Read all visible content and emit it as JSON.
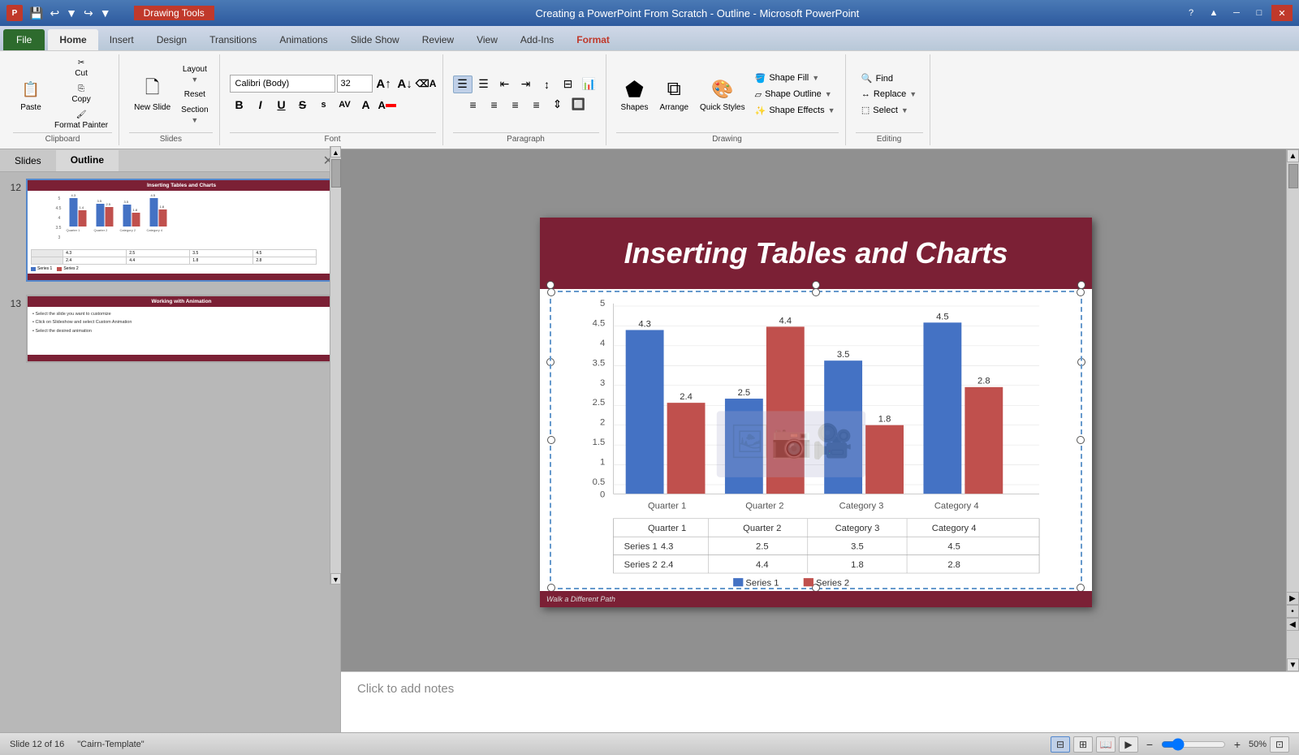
{
  "titleBar": {
    "appName": "Microsoft PowerPoint",
    "docTitle": "Creating a PowerPoint From Scratch - Outline - Microsoft PowerPoint",
    "drawingToolsTab": "Drawing Tools"
  },
  "tabs": {
    "file": "File",
    "home": "Home",
    "insert": "Insert",
    "design": "Design",
    "transitions": "Transitions",
    "animations": "Animations",
    "slideShow": "Slide Show",
    "review": "Review",
    "view": "View",
    "addIns": "Add-Ins",
    "format": "Format"
  },
  "ribbon": {
    "clipboard": {
      "label": "Clipboard",
      "paste": "Paste",
      "cut": "Cut",
      "copy": "Copy",
      "formatPainter": "Format Painter"
    },
    "slides": {
      "label": "Slides",
      "newSlide": "New Slide",
      "layout": "Layout",
      "reset": "Reset",
      "section": "Section"
    },
    "font": {
      "label": "Font",
      "fontName": "Calibri (Body)",
      "fontSize": "32",
      "bold": "B",
      "italic": "I",
      "underline": "U",
      "strikethrough": "S",
      "shadow": "s",
      "fontColor": "A"
    },
    "paragraph": {
      "label": "Paragraph",
      "bulletList": "≡",
      "numberedList": "≡",
      "decreaseIndent": "←",
      "increaseIndent": "→",
      "lineSpacing": "↕",
      "columns": "⊞"
    },
    "drawing": {
      "label": "Drawing",
      "shapes": "Shapes",
      "arrange": "Arrange",
      "quickStyles": "Quick Styles",
      "shapeFill": "Shape Fill",
      "shapeOutline": "Shape Outline",
      "shapeEffects": "Shape Effects"
    },
    "editing": {
      "label": "Editing",
      "find": "Find",
      "replace": "Replace",
      "select": "Select"
    }
  },
  "slidePanel": {
    "tabs": [
      "Slides",
      "Outline"
    ],
    "activeTab": "Outline",
    "slides": [
      {
        "number": "12",
        "title": "Inserting Tables and Charts",
        "isSelected": true
      },
      {
        "number": "13",
        "title": "Working with Animation",
        "isSelected": false
      }
    ]
  },
  "mainSlide": {
    "title": "Inserting Tables and Charts",
    "footerText": "Walk a Different Path",
    "chart": {
      "title": "",
      "categories": [
        "Quarter 1",
        "Quarter 2",
        "Category 3",
        "Category 4"
      ],
      "series1Label": "Series 1",
      "series2Label": "Series 2",
      "series1Values": [
        4.3,
        2.5,
        3.5,
        4.5
      ],
      "series2Values": [
        2.4,
        4.4,
        1.8,
        2.8
      ],
      "yAxisValues": [
        "0",
        "0.5",
        "1",
        "1.5",
        "2",
        "2.5",
        "3",
        "3.5",
        "4",
        "4.5",
        "5"
      ],
      "barLabels1": [
        "4.3",
        "2.5",
        "3.5",
        "4.5"
      ],
      "barLabels2": [
        "2.4",
        "4.4",
        "1.8",
        "2.8"
      ]
    },
    "table": {
      "headers": [
        "",
        "Quarter 1",
        "Quarter 2",
        "Category 3",
        "Category 4"
      ],
      "rows": [
        [
          "Series 1",
          "4.3",
          "2.5",
          "3.5",
          "4.5"
        ],
        [
          "Series 2",
          "2.4",
          "4.4",
          "1.8",
          "2.8"
        ]
      ]
    }
  },
  "slide13": {
    "title": "Working with Animation",
    "bullets": [
      "Select the slide you want to customize",
      "Click on Slideshow and select Custom Animation",
      "Select the desired animation"
    ]
  },
  "notesArea": {
    "placeholder": "Click to add notes"
  },
  "statusBar": {
    "slideInfo": "Slide 12 of 16",
    "theme": "\"Cairn-Template\"",
    "zoom": "50%"
  },
  "colors": {
    "darkRed": "#7b2035",
    "blue": "#4472c4",
    "red": "#c0504d",
    "accent": "#5588cc"
  }
}
